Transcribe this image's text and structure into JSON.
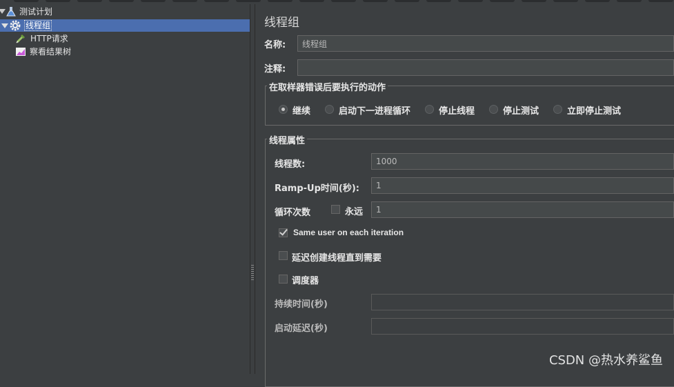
{
  "tree": {
    "items": [
      {
        "label": "测试计划",
        "icon": "test-plan-flask-icon"
      },
      {
        "label": "线程组",
        "icon": "thread-group-gear-icon",
        "selected": true
      },
      {
        "label": "HTTP请求",
        "icon": "http-request-pipette-icon"
      },
      {
        "label": "察看结果树",
        "icon": "view-results-tree-chart-icon"
      }
    ]
  },
  "panel": {
    "title": "线程组",
    "name_label": "名称:",
    "name_value": "线程组",
    "comment_label": "注释:",
    "comment_value": "",
    "error_action": {
      "legend": "在取样器错误后要执行的动作",
      "options": [
        "继续",
        "启动下一进程循环",
        "停止线程",
        "停止测试",
        "立即停止测试"
      ],
      "selected": "继续"
    },
    "thread_props": {
      "legend": "线程属性",
      "threads_label": "线程数:",
      "threads_value": "1000",
      "rampup_label": "Ramp-Up时间(秒):",
      "rampup_value": "1",
      "loop_label": "循环次数",
      "forever_label": "永远",
      "forever_checked": false,
      "loop_value": "1",
      "same_user_label": "Same user on each iteration",
      "same_user_checked": true,
      "delay_label": "延迟创建线程直到需要",
      "delay_checked": false,
      "scheduler_label": "调度器",
      "scheduler_checked": false,
      "duration_label": "持续时间(秒)",
      "duration_value": "",
      "startup_delay_label": "启动延迟(秒)",
      "startup_delay_value": ""
    }
  },
  "watermark": "CSDN @热水养鲨鱼",
  "colors": {
    "background": "#3c3f41",
    "selection": "#4b6eaf",
    "field": "#45494a",
    "text": "#bbbbbb"
  }
}
